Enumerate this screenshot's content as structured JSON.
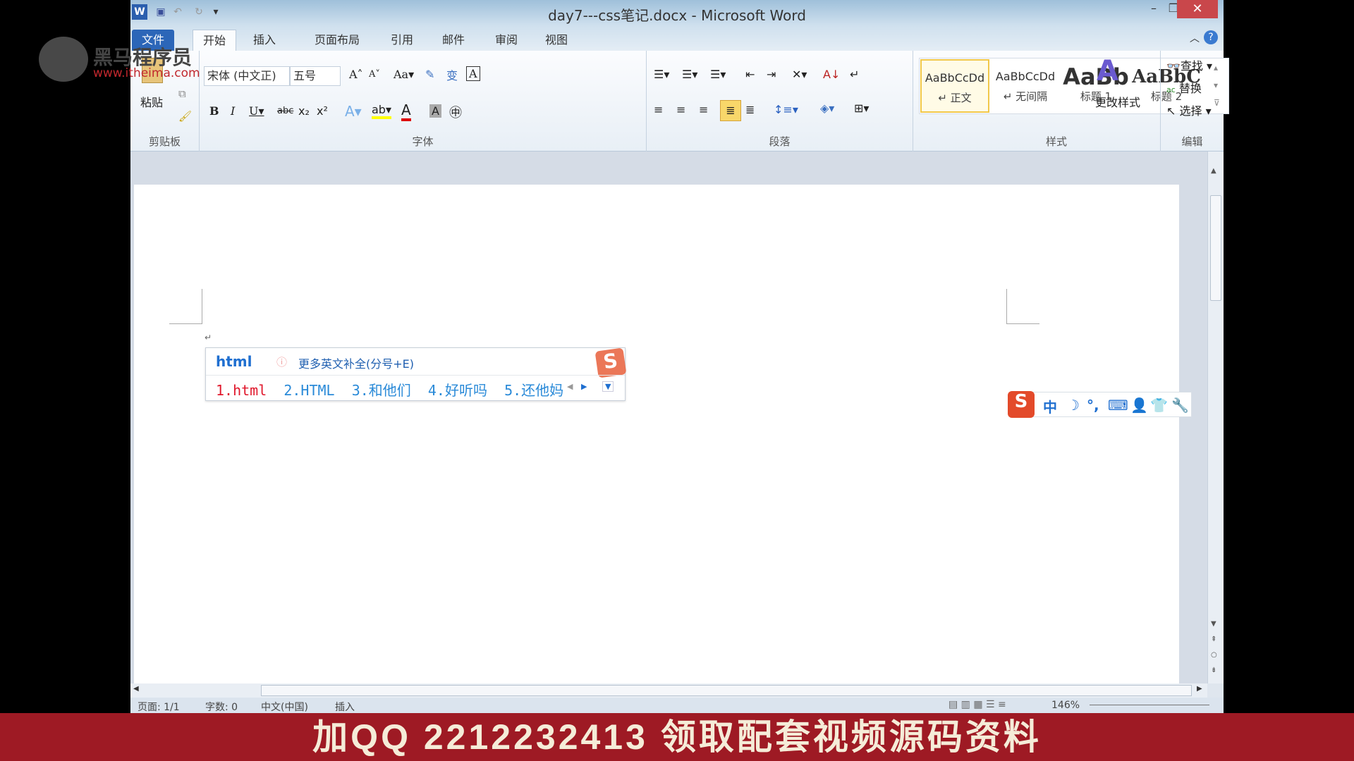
{
  "window": {
    "title": "day7---css笔记.docx - Microsoft Word"
  },
  "tabs": [
    "文件",
    "开始",
    "插入",
    "页面布局",
    "引用",
    "邮件",
    "审阅",
    "视图"
  ],
  "ribbon": {
    "clipboard": {
      "paste": "粘贴",
      "label": "剪贴板"
    },
    "font": {
      "name": "宋体 (中文正)",
      "size": "五号",
      "label": "字体"
    },
    "paragraph": {
      "label": "段落"
    },
    "styles": {
      "label": "样式",
      "items": [
        {
          "preview": "AaBbCcDd",
          "name": "↵ 正文"
        },
        {
          "preview": "AaBbCcDd",
          "name": "↵ 无间隔"
        },
        {
          "preview": "AaBb",
          "name": "标题 1"
        },
        {
          "preview": "AaBbC",
          "name": "标题 2"
        }
      ],
      "change": "更改样式"
    },
    "editing": {
      "label": "编辑",
      "find": "查找",
      "replace": "替换",
      "select": "选择"
    }
  },
  "watermark": {
    "brand": "黑马程序员",
    "url": "www.itheima.com"
  },
  "ime_popup": {
    "input": "html",
    "hint": "更多英文补全(分号+E)",
    "candidates": [
      "1.html",
      "2.HTML",
      "3.和他们",
      "4.好听吗",
      "5.还他妈"
    ]
  },
  "ime_toolbar": {
    "mode": "中"
  },
  "status": {
    "page": "页面: 1/1",
    "words": "字数: 0",
    "lang": "中文(中国)",
    "mode": "插入",
    "zoom": "146%"
  },
  "banner": "加QQ 2212232413  领取配套视频源码资料"
}
